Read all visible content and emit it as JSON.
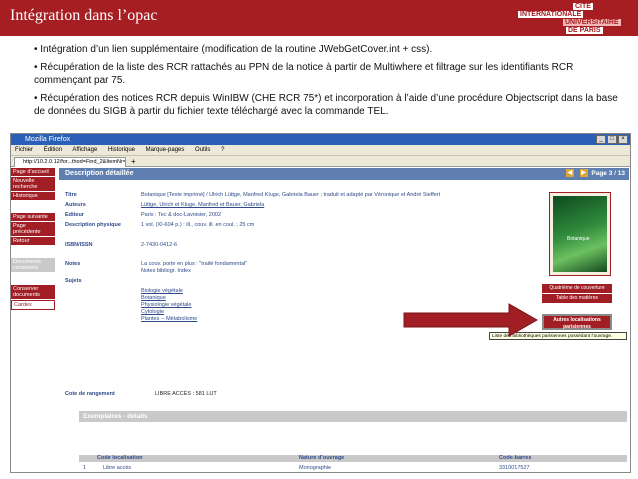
{
  "slide": {
    "title": "Intégration dans l’opac",
    "logo": [
      "CITÉ",
      "INTERNATIONALE",
      "UNIVERSITAIRE",
      "DE PARIS"
    ],
    "bullets": [
      "• Intégration d’un lien supplémentaire (modification de la routine JWebGetCover.int + css).",
      "• Récupération de la liste des RCR rattachés au PPN de la notice à partir de Multiwhere et filtrage sur les identifiants RCR commençant par 75.",
      "• Récupération des notices RCR depuis WinIBW (CHE RCR 75*) et incorporation à l’aide d’une procédure Objectscript dans la base de données du SIGB à partir du fichier texte téléchargé avec la commande TEL."
    ]
  },
  "browser": {
    "title": "Mozilla Firefox",
    "menu": [
      "Fichier",
      "Édition",
      "Affichage",
      "Historique",
      "Marque-pages",
      "Outils",
      "?"
    ],
    "tab_label": "http://10.2.0.12/for...thod=Find_2&ItemNr=3",
    "tab_plus": "+"
  },
  "sidebar": [
    {
      "label": "Page d’accueil",
      "style": "dark"
    },
    {
      "label": "Nouvelle recherche",
      "style": "dark"
    },
    {
      "label": "Historique",
      "style": "dark"
    },
    {
      "label": "Page suivante",
      "style": "dark"
    },
    {
      "label": "Page précédente",
      "style": "dark"
    },
    {
      "label": "Retour",
      "style": "dark"
    },
    {
      "label": "Documents conservés",
      "style": "light"
    },
    {
      "label": "Conserver documents",
      "style": "dark"
    },
    {
      "label": "Cardex",
      "style": "outline"
    }
  ],
  "record": {
    "banner": "Description détaillée",
    "pager": "Page 3 / 13",
    "fields": [
      {
        "label": "Titre",
        "value": "Botanique [Texte imprimé] / Ulrich Lüttge, Manfred Kluge, Gabriela Bauer ; traduit et adapté par Véronique et André Sieffert"
      },
      {
        "label": "Auteurs",
        "value": "Lüttge, Ulrich et Kluge, Manfred et Bauer, Gabriela"
      },
      {
        "label": "Editeur",
        "value": "Paris : Tec & doc-Lavoisier, 2002"
      },
      {
        "label": "Description physique",
        "value": "1 vol. (XI-604 p.) : ill., couv. ill. en coul. ; 25 cm"
      },
      {
        "label": "ISBN/ISSN",
        "value": "2-7430-0412-6"
      },
      {
        "label": "Notes",
        "value": "La couv. porte en plus : \"traité fondamental\""
      },
      {
        "label": "",
        "value": "Notes bibliogr. Index"
      },
      {
        "label": "Sujets",
        "value": ""
      }
    ],
    "subjects": [
      "Biologie végétale",
      "Botanique",
      "Physiologie végétale",
      "Cytologie",
      "Plantes -- Métabolisme"
    ],
    "cover_text": "Botanique",
    "cover_buttons": [
      "Quatrième de couverture",
      "Table des matières"
    ],
    "localisations_button": "Autres localisations parisiennes",
    "tooltip": "Liste des bibliothèques parisiennes possédant l’ouvrage.",
    "cote_label": "Cote de rangement",
    "cote_value": "LIBRE ACCÈS : 581 LUT",
    "exemplaires_title": "Exemplaires - détails",
    "columns": [
      "Code localisation",
      "Nature d’ouvrage",
      "Code-barres"
    ],
    "row": {
      "num": "1",
      "loc": "Libre accès",
      "nature": "Monographie",
      "barcode": "3310017527"
    }
  },
  "colors": {
    "brand": "#a61d22",
    "banner": "#5e7fb0",
    "link": "#2e4a8a"
  }
}
